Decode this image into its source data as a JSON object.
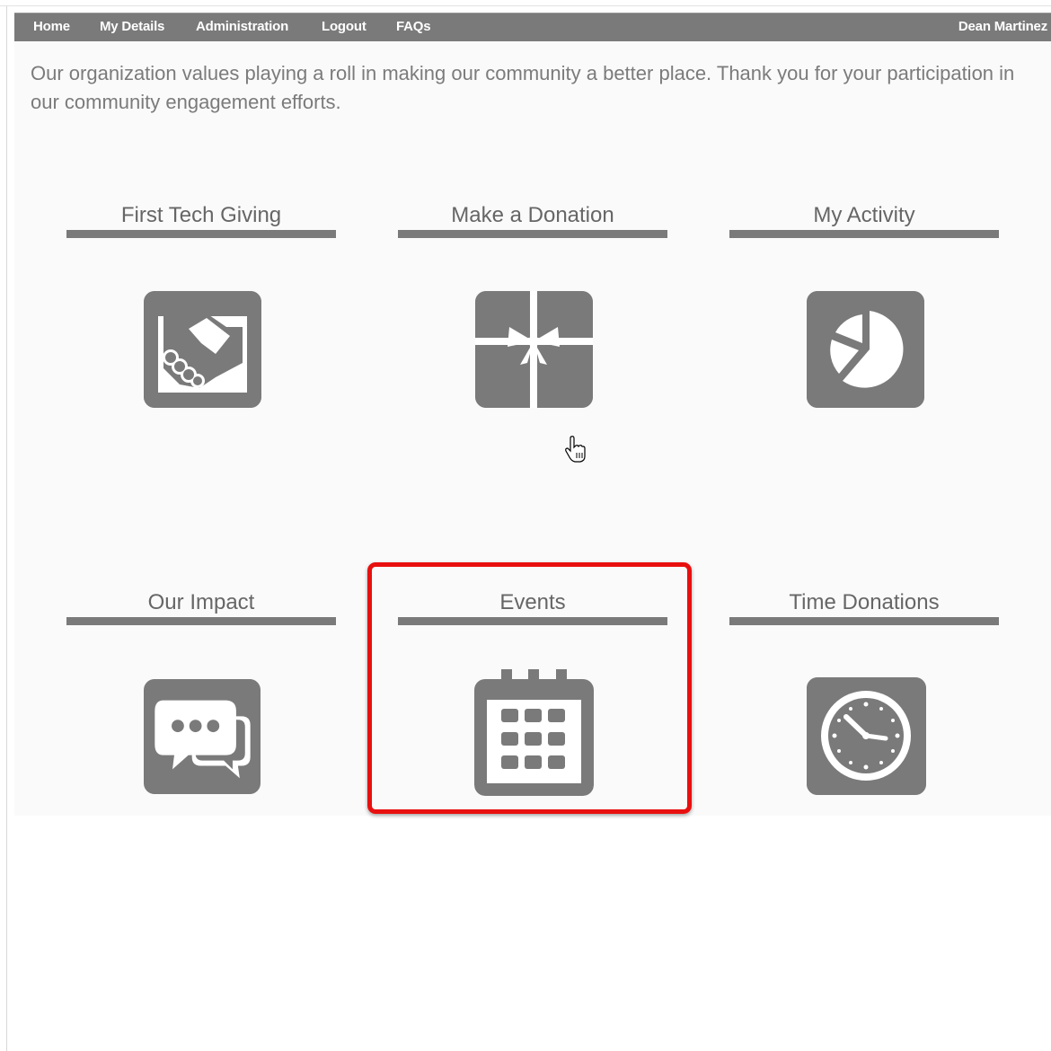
{
  "nav": {
    "items": [
      {
        "label": "Home"
      },
      {
        "label": "My Details"
      },
      {
        "label": "Administration"
      },
      {
        "label": "Logout"
      },
      {
        "label": "FAQs"
      }
    ],
    "user_name": "Dean Martinez"
  },
  "intro": {
    "text": "Our organization values playing a roll in making our community a better place. Thank you for your participation in our community engagement efforts."
  },
  "tiles": [
    {
      "title": "First Tech Giving",
      "icon": "handshake-icon"
    },
    {
      "title": "Make a Donation",
      "icon": "gift-icon"
    },
    {
      "title": "My Activity",
      "icon": "pie-chart-icon"
    },
    {
      "title": "Our Impact",
      "icon": "chat-bubbles-icon"
    },
    {
      "title": "Events",
      "icon": "calendar-icon",
      "highlighted": true
    },
    {
      "title": "Time Donations",
      "icon": "clock-icon"
    }
  ],
  "colors": {
    "nav_bg": "#7a7a7a",
    "icon_bg": "#7a7a7a",
    "text": "#7b7b7b",
    "title": "#666666",
    "highlight": "#e8100f"
  }
}
